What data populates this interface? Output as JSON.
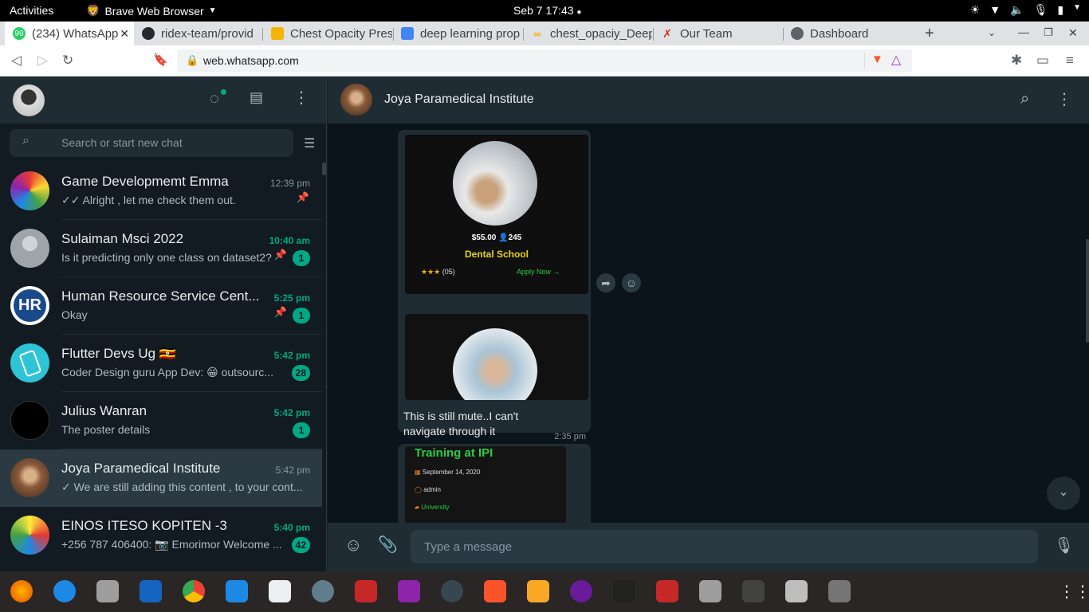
{
  "system_bar": {
    "activities": "Activities",
    "app_name": "Brave Web Browser",
    "clock": "Seb 7  17:43"
  },
  "tabs": [
    {
      "label": "(234) WhatsApp",
      "favicon": "whatsapp-icon",
      "color": "#25d366"
    },
    {
      "label": "ridex-team/provid",
      "favicon": "github-icon",
      "color": "#24292e"
    },
    {
      "label": "Chest Opacity Pres",
      "favicon": "slides-icon",
      "color": "#f4b400"
    },
    {
      "label": "deep learning prop",
      "favicon": "docs-icon",
      "color": "#4285f4"
    },
    {
      "label": "chest_opaciy_Deep",
      "favicon": "colab-icon",
      "color": "#f9ab00"
    },
    {
      "label": "Our Team",
      "favicon": "team-icon",
      "color": "#d93025"
    },
    {
      "label": "Dashboard",
      "favicon": "globe-icon",
      "color": "#5f6368"
    }
  ],
  "address_bar": {
    "url": "web.whatsapp.com"
  },
  "sidebar": {
    "search_placeholder": "Search or start new chat",
    "chats": [
      {
        "name": "Game Developmemt Emma",
        "time": "12:39 pm",
        "message": "✓✓ Alright , let me check them out.",
        "unread": "",
        "pinned": true
      },
      {
        "name": "Sulaiman Msci 2022",
        "time": "10:40 am",
        "message": "Is it predicting only one class on dataset2?",
        "unread": "1",
        "pinned": true
      },
      {
        "name": "Human Resource Service Cent...",
        "time": "5:25 pm",
        "message": "Okay",
        "unread": "1",
        "pinned": true
      },
      {
        "name": "Flutter Devs Ug 🇺🇬",
        "time": "5:42 pm",
        "message": "Coder Design guru App Dev: 😁 outsourc...",
        "unread": "28",
        "pinned": false
      },
      {
        "name": "Julius Wanran",
        "time": "5:42 pm",
        "message": "The poster details",
        "unread": "1",
        "pinned": false
      },
      {
        "name": "Joya Paramedical Institute",
        "time": "5:42 pm",
        "message": "✓ We are still adding this content , to your cont...",
        "unread": "",
        "pinned": false
      },
      {
        "name": "EINOS ITESO KOPITEN -3",
        "time": "5:40 pm",
        "message": "+256 787 406400: 📷 Emorimor  Welcome ...",
        "unread": "42",
        "pinned": false
      }
    ]
  },
  "conversation": {
    "title": "Joya Paramedical Institute",
    "card1": {
      "price": "$55.00",
      "students": "245",
      "course": "Dental School",
      "rating": "(05)",
      "cta": "Apply Now"
    },
    "message_text": "This is still mute..I can't navigate through it",
    "message_time": "2:35 pm",
    "card3": {
      "title": "Training at IPI",
      "date": "September 14, 2020",
      "author": "admin",
      "category": "University"
    },
    "input_placeholder": "Type a message"
  },
  "colors": {
    "accent": "#00a884",
    "panel": "#202c33",
    "background": "#111b21"
  }
}
